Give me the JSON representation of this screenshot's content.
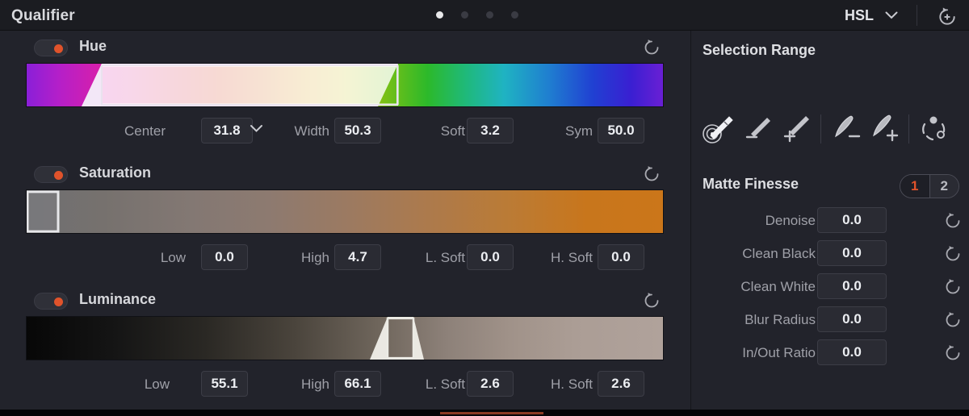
{
  "titlebar": {
    "title": "Qualifier",
    "mode_label": "HSL",
    "mode_chevron_icon": "chevron-down-icon",
    "reset_icon": "reset-all-icon",
    "pager_dots": [
      {
        "active": true
      },
      {
        "active": false
      },
      {
        "active": false
      },
      {
        "active": false
      }
    ]
  },
  "qualifier": {
    "hue": {
      "title": "Hue",
      "enabled": true,
      "reset_icon": "reset-icon",
      "fields": [
        {
          "label": "Center",
          "value": "31.8",
          "has_dropdown": true
        },
        {
          "label": "Width",
          "value": "50.3",
          "has_dropdown": false
        },
        {
          "label": "Soft",
          "value": "3.2",
          "has_dropdown": false
        },
        {
          "label": "Sym",
          "value": "50.0",
          "has_dropdown": false
        }
      ]
    },
    "saturation": {
      "title": "Saturation",
      "enabled": true,
      "reset_icon": "reset-icon",
      "fields": [
        {
          "label": "Low",
          "value": "0.0"
        },
        {
          "label": "High",
          "value": "4.7"
        },
        {
          "label": "L. Soft",
          "value": "0.0"
        },
        {
          "label": "H. Soft",
          "value": "0.0"
        }
      ]
    },
    "luminance": {
      "title": "Luminance",
      "enabled": true,
      "reset_icon": "reset-icon",
      "fields": [
        {
          "label": "Low",
          "value": "55.1"
        },
        {
          "label": "High",
          "value": "66.1"
        },
        {
          "label": "L. Soft",
          "value": "2.6"
        },
        {
          "label": "H. Soft",
          "value": "2.6"
        }
      ]
    }
  },
  "selection_range": {
    "title": "Selection Range",
    "tools": [
      {
        "name": "picker-target-icon",
        "active": true
      },
      {
        "name": "picker-minus-icon",
        "active": false
      },
      {
        "name": "picker-plus-icon",
        "active": false
      },
      {
        "name": "divider",
        "active": false
      },
      {
        "name": "brush-minus-icon",
        "active": false
      },
      {
        "name": "brush-plus-icon",
        "active": false
      },
      {
        "name": "divider",
        "active": false
      },
      {
        "name": "refine-nodes-icon",
        "active": false
      }
    ]
  },
  "matte_finesse": {
    "title": "Matte Finesse",
    "pages": [
      {
        "label": "1",
        "active": true
      },
      {
        "label": "2",
        "active": false
      }
    ],
    "rows": [
      {
        "label": "Denoise",
        "value": "0.0",
        "reset_icon": "reset-icon"
      },
      {
        "label": "Clean Black",
        "value": "0.0",
        "reset_icon": "reset-icon"
      },
      {
        "label": "Clean White",
        "value": "0.0",
        "reset_icon": "reset-icon"
      },
      {
        "label": "Blur Radius",
        "value": "0.0",
        "reset_icon": "reset-icon"
      },
      {
        "label": "In/Out Ratio",
        "value": "0.0",
        "reset_icon": "reset-icon"
      }
    ]
  },
  "colors": {
    "accent": "#e0532b",
    "panel_bg": "#22232b",
    "titlebar_bg": "#1b1c21",
    "field_bg": "#2a2b33",
    "label_text": "#9fa0a8",
    "value_text": "#eceef2"
  }
}
